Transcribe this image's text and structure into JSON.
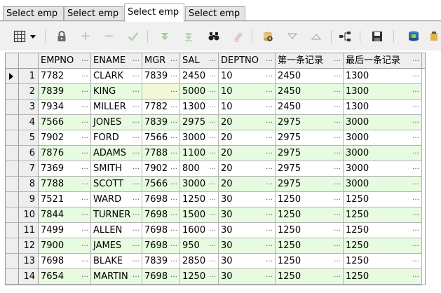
{
  "tabs": [
    {
      "label": "Select emp",
      "active": false
    },
    {
      "label": "Select emp",
      "active": false
    },
    {
      "label": "Select emp",
      "active": true
    },
    {
      "label": "Select emp",
      "active": false
    }
  ],
  "toolbar": {
    "icons": [
      "grid-layout-icon",
      "dropdown-arrow-icon",
      "lock-icon",
      "add-record-icon",
      "delete-record-icon",
      "post-edit-icon",
      "filter-down-icon",
      "filter-clear-icon",
      "find-binoculars-icon",
      "clear-eraser-icon",
      "query-by-example-icon",
      "sort-descending-icon",
      "sort-ascending-icon",
      "link-icon",
      "save-disk-icon",
      "export-icon",
      "more-icon"
    ]
  },
  "grid": {
    "columns": [
      "EMPNO",
      "ENAME",
      "MGR",
      "SAL",
      "DEPTNO",
      "第一条记录",
      "最后一条记录"
    ],
    "current_row": 1,
    "rows": [
      {
        "num": "1",
        "cells": [
          "7782",
          "CLARK",
          "7839",
          "2450",
          "10",
          "2450",
          "1300"
        ]
      },
      {
        "num": "2",
        "cells": [
          "7839",
          "KING",
          "",
          "5000",
          "10",
          "2450",
          "1300"
        ]
      },
      {
        "num": "3",
        "cells": [
          "7934",
          "MILLER",
          "7782",
          "1300",
          "10",
          "2450",
          "1300"
        ]
      },
      {
        "num": "4",
        "cells": [
          "7566",
          "JONES",
          "7839",
          "2975",
          "20",
          "2975",
          "3000"
        ]
      },
      {
        "num": "5",
        "cells": [
          "7902",
          "FORD",
          "7566",
          "3000",
          "20",
          "2975",
          "3000"
        ]
      },
      {
        "num": "6",
        "cells": [
          "7876",
          "ADAMS",
          "7788",
          "1100",
          "20",
          "2975",
          "3000"
        ]
      },
      {
        "num": "7",
        "cells": [
          "7369",
          "SMITH",
          "7902",
          "800",
          "20",
          "2975",
          "3000"
        ]
      },
      {
        "num": "8",
        "cells": [
          "7788",
          "SCOTT",
          "7566",
          "3000",
          "20",
          "2975",
          "3000"
        ]
      },
      {
        "num": "9",
        "cells": [
          "7521",
          "WARD",
          "7698",
          "1250",
          "30",
          "1250",
          "1250"
        ]
      },
      {
        "num": "10",
        "cells": [
          "7844",
          "TURNER",
          "7698",
          "1500",
          "30",
          "1250",
          "1250"
        ]
      },
      {
        "num": "11",
        "cells": [
          "7499",
          "ALLEN",
          "7698",
          "1600",
          "30",
          "1250",
          "1250"
        ]
      },
      {
        "num": "12",
        "cells": [
          "7900",
          "JAMES",
          "7698",
          "950",
          "30",
          "1250",
          "1250"
        ]
      },
      {
        "num": "13",
        "cells": [
          "7698",
          "BLAKE",
          "7839",
          "2850",
          "30",
          "1250",
          "1250"
        ]
      },
      {
        "num": "14",
        "cells": [
          "7654",
          "MARTIN",
          "7698",
          "1250",
          "30",
          "1250",
          "1250"
        ]
      }
    ]
  }
}
